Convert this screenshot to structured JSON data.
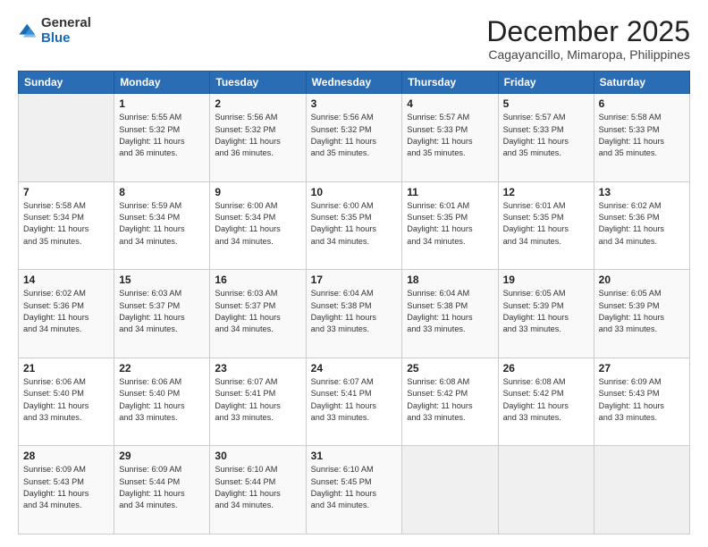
{
  "logo": {
    "general": "General",
    "blue": "Blue"
  },
  "header": {
    "title": "December 2025",
    "location": "Cagayancillo, Mimaropa, Philippines"
  },
  "days": [
    "Sunday",
    "Monday",
    "Tuesday",
    "Wednesday",
    "Thursday",
    "Friday",
    "Saturday"
  ],
  "weeks": [
    [
      {
        "day": "",
        "info": ""
      },
      {
        "day": "1",
        "info": "Sunrise: 5:55 AM\nSunset: 5:32 PM\nDaylight: 11 hours\nand 36 minutes."
      },
      {
        "day": "2",
        "info": "Sunrise: 5:56 AM\nSunset: 5:32 PM\nDaylight: 11 hours\nand 36 minutes."
      },
      {
        "day": "3",
        "info": "Sunrise: 5:56 AM\nSunset: 5:32 PM\nDaylight: 11 hours\nand 35 minutes."
      },
      {
        "day": "4",
        "info": "Sunrise: 5:57 AM\nSunset: 5:33 PM\nDaylight: 11 hours\nand 35 minutes."
      },
      {
        "day": "5",
        "info": "Sunrise: 5:57 AM\nSunset: 5:33 PM\nDaylight: 11 hours\nand 35 minutes."
      },
      {
        "day": "6",
        "info": "Sunrise: 5:58 AM\nSunset: 5:33 PM\nDaylight: 11 hours\nand 35 minutes."
      }
    ],
    [
      {
        "day": "7",
        "info": "Sunrise: 5:58 AM\nSunset: 5:34 PM\nDaylight: 11 hours\nand 35 minutes."
      },
      {
        "day": "8",
        "info": "Sunrise: 5:59 AM\nSunset: 5:34 PM\nDaylight: 11 hours\nand 34 minutes."
      },
      {
        "day": "9",
        "info": "Sunrise: 6:00 AM\nSunset: 5:34 PM\nDaylight: 11 hours\nand 34 minutes."
      },
      {
        "day": "10",
        "info": "Sunrise: 6:00 AM\nSunset: 5:35 PM\nDaylight: 11 hours\nand 34 minutes."
      },
      {
        "day": "11",
        "info": "Sunrise: 6:01 AM\nSunset: 5:35 PM\nDaylight: 11 hours\nand 34 minutes."
      },
      {
        "day": "12",
        "info": "Sunrise: 6:01 AM\nSunset: 5:35 PM\nDaylight: 11 hours\nand 34 minutes."
      },
      {
        "day": "13",
        "info": "Sunrise: 6:02 AM\nSunset: 5:36 PM\nDaylight: 11 hours\nand 34 minutes."
      }
    ],
    [
      {
        "day": "14",
        "info": "Sunrise: 6:02 AM\nSunset: 5:36 PM\nDaylight: 11 hours\nand 34 minutes."
      },
      {
        "day": "15",
        "info": "Sunrise: 6:03 AM\nSunset: 5:37 PM\nDaylight: 11 hours\nand 34 minutes."
      },
      {
        "day": "16",
        "info": "Sunrise: 6:03 AM\nSunset: 5:37 PM\nDaylight: 11 hours\nand 34 minutes."
      },
      {
        "day": "17",
        "info": "Sunrise: 6:04 AM\nSunset: 5:38 PM\nDaylight: 11 hours\nand 33 minutes."
      },
      {
        "day": "18",
        "info": "Sunrise: 6:04 AM\nSunset: 5:38 PM\nDaylight: 11 hours\nand 33 minutes."
      },
      {
        "day": "19",
        "info": "Sunrise: 6:05 AM\nSunset: 5:39 PM\nDaylight: 11 hours\nand 33 minutes."
      },
      {
        "day": "20",
        "info": "Sunrise: 6:05 AM\nSunset: 5:39 PM\nDaylight: 11 hours\nand 33 minutes."
      }
    ],
    [
      {
        "day": "21",
        "info": "Sunrise: 6:06 AM\nSunset: 5:40 PM\nDaylight: 11 hours\nand 33 minutes."
      },
      {
        "day": "22",
        "info": "Sunrise: 6:06 AM\nSunset: 5:40 PM\nDaylight: 11 hours\nand 33 minutes."
      },
      {
        "day": "23",
        "info": "Sunrise: 6:07 AM\nSunset: 5:41 PM\nDaylight: 11 hours\nand 33 minutes."
      },
      {
        "day": "24",
        "info": "Sunrise: 6:07 AM\nSunset: 5:41 PM\nDaylight: 11 hours\nand 33 minutes."
      },
      {
        "day": "25",
        "info": "Sunrise: 6:08 AM\nSunset: 5:42 PM\nDaylight: 11 hours\nand 33 minutes."
      },
      {
        "day": "26",
        "info": "Sunrise: 6:08 AM\nSunset: 5:42 PM\nDaylight: 11 hours\nand 33 minutes."
      },
      {
        "day": "27",
        "info": "Sunrise: 6:09 AM\nSunset: 5:43 PM\nDaylight: 11 hours\nand 33 minutes."
      }
    ],
    [
      {
        "day": "28",
        "info": "Sunrise: 6:09 AM\nSunset: 5:43 PM\nDaylight: 11 hours\nand 34 minutes."
      },
      {
        "day": "29",
        "info": "Sunrise: 6:09 AM\nSunset: 5:44 PM\nDaylight: 11 hours\nand 34 minutes."
      },
      {
        "day": "30",
        "info": "Sunrise: 6:10 AM\nSunset: 5:44 PM\nDaylight: 11 hours\nand 34 minutes."
      },
      {
        "day": "31",
        "info": "Sunrise: 6:10 AM\nSunset: 5:45 PM\nDaylight: 11 hours\nand 34 minutes."
      },
      {
        "day": "",
        "info": ""
      },
      {
        "day": "",
        "info": ""
      },
      {
        "day": "",
        "info": ""
      }
    ]
  ]
}
